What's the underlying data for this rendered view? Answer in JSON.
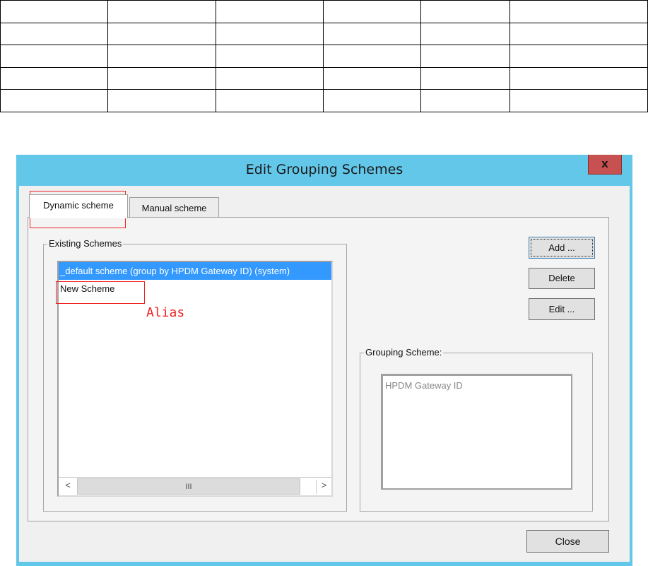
{
  "table": {
    "rows": [
      [
        "",
        "",
        "",
        "",
        "",
        ""
      ],
      [
        "",
        "",
        "",
        "",
        "",
        ""
      ],
      [
        "",
        "",
        "",
        "",
        "",
        ""
      ],
      [
        "",
        "",
        "",
        "",
        "",
        ""
      ],
      [
        "",
        "",
        "",
        "",
        "",
        ""
      ]
    ]
  },
  "dialog": {
    "title": "Edit Grouping Schemes",
    "close_x": "x",
    "tabs": [
      {
        "label": "Dynamic scheme",
        "active": true
      },
      {
        "label": "Manual scheme",
        "active": false
      }
    ],
    "existing_schemes": {
      "label": "Existing Schemes",
      "items": [
        "_default scheme (group by HPDM Gateway ID) (system)",
        "New Scheme"
      ],
      "scrollbar": {
        "left": "<",
        "thumb": "III",
        "right": ">"
      }
    },
    "buttons": {
      "add": "Add ...",
      "delete": "Delete",
      "edit": "Edit ..."
    },
    "grouping_scheme": {
      "label": "Grouping Scheme:",
      "value": "HPDM Gateway ID"
    },
    "close_button": "Close"
  },
  "annotation": {
    "text": "Alias",
    "color": "#ee2222"
  },
  "colors": {
    "title_bar": "#63c7ea",
    "selection": "#3399ff",
    "close_x_bg": "#c75050"
  }
}
